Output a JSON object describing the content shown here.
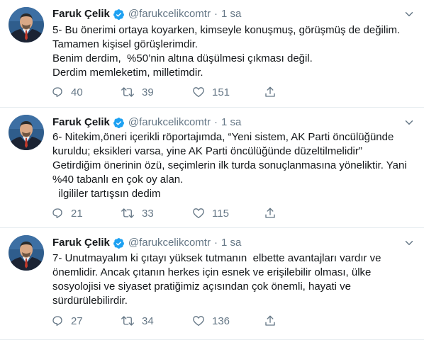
{
  "tweets": [
    {
      "name": "Faruk Çelik",
      "handle": "@farukcelikcomtr",
      "separator": "·",
      "time": "1 sa",
      "lines": [
        "5- Bu önerimi ortaya koyarken, kimseyle konuşmuş, görüşmüş de değilim.",
        "Tamamen kişisel görüşlerimdir.",
        "Benim derdim,  %50’nin altına düşülmesi çıkması değil.",
        "Derdim memleketim, milletimdir."
      ],
      "replies": "40",
      "retweets": "39",
      "likes": "151"
    },
    {
      "name": "Faruk Çelik",
      "handle": "@farukcelikcomtr",
      "separator": "·",
      "time": "1 sa",
      "lines": [
        "6- Nitekim,öneri içerikli röportajımda, “Yeni sistem, AK Parti öncülüğünde",
        "kuruldu; eksikleri varsa, yine AK Parti öncülüğünde düzeltilmelidir”",
        "Getirdiğim önerinin özü, seçimlerin ilk turda sonuçlanmasına yöneliktir. Yani",
        "%40 tabanlı en çok oy alan.",
        "  ilgililer tartışsın dedim"
      ],
      "replies": "21",
      "retweets": "33",
      "likes": "115"
    },
    {
      "name": "Faruk Çelik",
      "handle": "@farukcelikcomtr",
      "separator": "·",
      "time": "1 sa",
      "lines": [
        "7- Unutmayalım ki çıtayı yüksek tutmanın  elbette avantajları vardır ve",
        "önemlidir. Ancak çıtanın herkes için esnek ve erişilebilir olması, ülke",
        "sosyolojisi ve siyaset pratiğimiz açısından çok önemli, hayati ve",
        "sürdürülebilirdir."
      ],
      "replies": "27",
      "retweets": "34",
      "likes": "136"
    }
  ],
  "icons": {
    "verified": "verified-badge-icon",
    "caret": "chevron-down-icon",
    "reply": "reply-icon",
    "retweet": "retweet-icon",
    "like": "heart-icon",
    "share": "share-icon"
  },
  "colors": {
    "text": "#14171a",
    "secondary": "#657786",
    "verified": "#1da1f2",
    "divider": "#e6ecf0"
  }
}
